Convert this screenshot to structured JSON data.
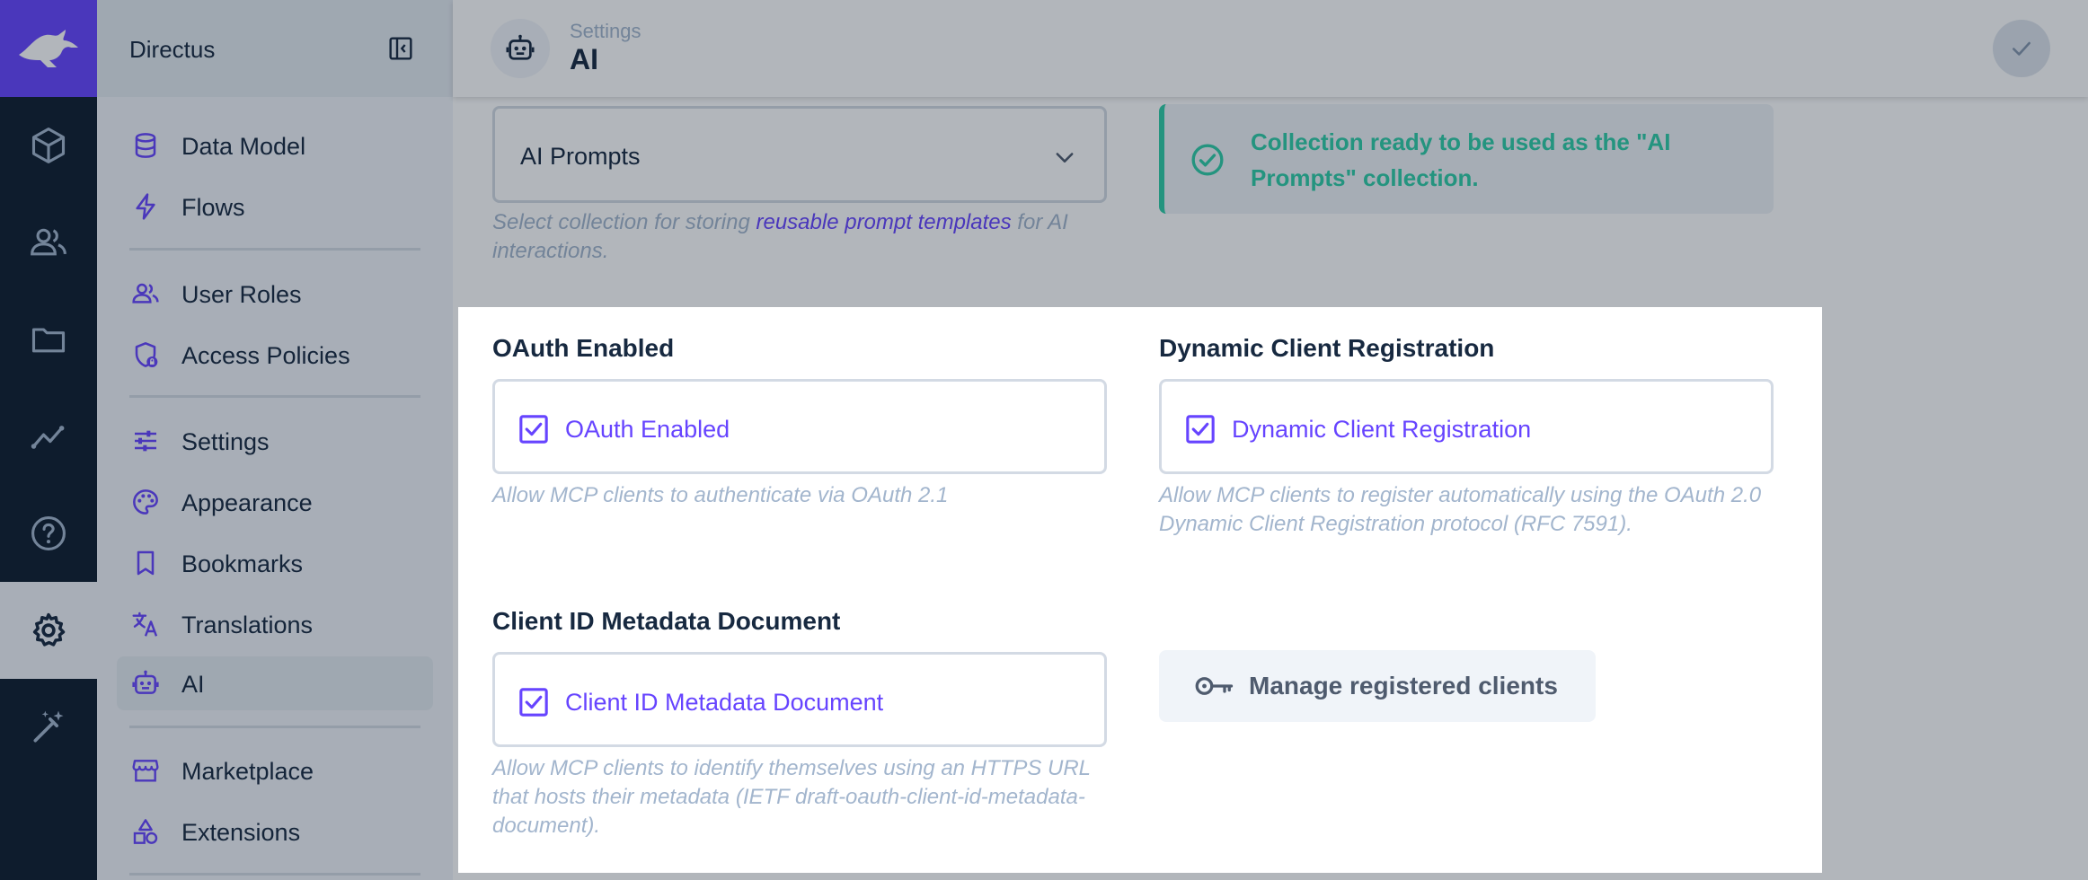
{
  "app": {
    "project_name": "Directus"
  },
  "header": {
    "breadcrumb": "Settings",
    "title": "AI"
  },
  "nav": {
    "items": [
      {
        "label": "Data Model",
        "icon": "database-icon"
      },
      {
        "label": "Flows",
        "icon": "bolt-icon"
      },
      {
        "label": "User Roles",
        "icon": "group-icon"
      },
      {
        "label": "Access Policies",
        "icon": "shield-lock-icon"
      },
      {
        "label": "Settings",
        "icon": "tune-icon"
      },
      {
        "label": "Appearance",
        "icon": "palette-icon"
      },
      {
        "label": "Bookmarks",
        "icon": "bookmark-icon"
      },
      {
        "label": "Translations",
        "icon": "translate-icon"
      },
      {
        "label": "AI",
        "icon": "smart-toy-icon",
        "active": true
      },
      {
        "label": "Marketplace",
        "icon": "storefront-icon"
      },
      {
        "label": "Extensions",
        "icon": "category-icon"
      }
    ]
  },
  "form": {
    "prompts_select": {
      "value": "AI Prompts",
      "hint_prefix": "Select collection for storing ",
      "hint_link": "reusable prompt templates",
      "hint_suffix": " for AI interactions."
    },
    "notice": {
      "text": "Collection ready to be used as the \"AI Prompts\" collection."
    },
    "oauth_enabled": {
      "label": "OAuth Enabled",
      "checkbox_label": "OAuth Enabled",
      "checked": true,
      "hint": "Allow MCP clients to authenticate via OAuth 2.1"
    },
    "dynamic_registration": {
      "label": "Dynamic Client Registration",
      "checkbox_label": "Dynamic Client Registration",
      "checked": true,
      "hint": "Allow MCP clients to register automatically using the OAuth 2.0 Dynamic Client Registration protocol (RFC 7591)."
    },
    "client_id_metadata": {
      "label": "Client ID Metadata Document",
      "checkbox_label": "Client ID Metadata Document",
      "checked": true,
      "hint": "Allow MCP clients to identify themselves using an HTTPS URL that hosts their metadata (IETF draft-oauth-client-id-metadata-document)."
    },
    "manage_clients_button": {
      "label": "Manage registered clients",
      "icon": "key-icon"
    }
  },
  "colors": {
    "accent": "#6644ff",
    "success": "#2ecda7",
    "rail": "#0e1c2f"
  }
}
